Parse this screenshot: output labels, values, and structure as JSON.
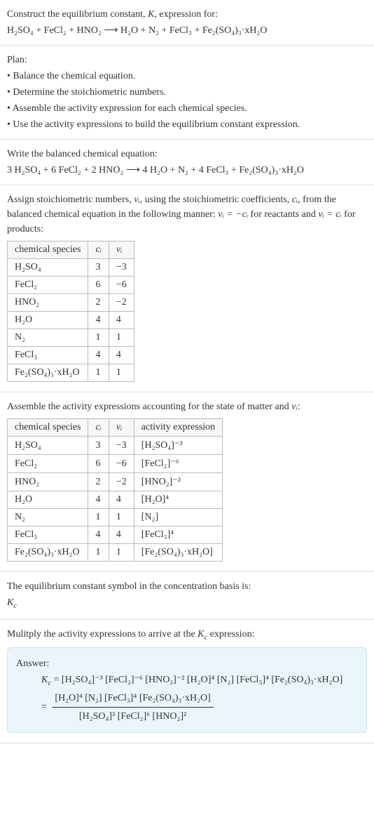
{
  "intro": {
    "line1_prefix": "Construct the equilibrium constant, ",
    "line1_K": "K",
    "line1_suffix": ", expression for:",
    "reaction_unbalanced": "H₂SO₄ + FeCl₂ + HNO₂ ⟶ H₂O + N₂ + FeCl₃ + Fe₂(SO₄)₃·xH₂O"
  },
  "plan": {
    "heading": "Plan:",
    "items": [
      "• Balance the chemical equation.",
      "• Determine the stoichiometric numbers.",
      "• Assemble the activity expression for each chemical species.",
      "• Use the activity expressions to build the equilibrium constant expression."
    ]
  },
  "balanced": {
    "heading": "Write the balanced chemical equation:",
    "reaction": "3 H₂SO₄ + 6 FeCl₂ + 2 HNO₂ ⟶ 4 H₂O + N₂ + 4 FeCl₃ + Fe₂(SO₄)₃·xH₂O"
  },
  "stoich": {
    "desc_prefix": "Assign stoichiometric numbers, ",
    "nu_i": "νᵢ",
    "desc_mid1": ", using the stoichiometric coefficients, ",
    "c_i": "cᵢ",
    "desc_mid2": ", from the balanced chemical equation in the following manner: ",
    "rule1": "νᵢ = −cᵢ",
    "desc_mid3": " for reactants and ",
    "rule2": "νᵢ = cᵢ",
    "desc_suffix": " for products:",
    "headers": [
      "chemical species",
      "cᵢ",
      "νᵢ"
    ],
    "rows": [
      [
        "H₂SO₄",
        "3",
        "−3"
      ],
      [
        "FeCl₂",
        "6",
        "−6"
      ],
      [
        "HNO₂",
        "2",
        "−2"
      ],
      [
        "H₂O",
        "4",
        "4"
      ],
      [
        "N₂",
        "1",
        "1"
      ],
      [
        "FeCl₃",
        "4",
        "4"
      ],
      [
        "Fe₂(SO₄)₃·xH₂O",
        "1",
        "1"
      ]
    ]
  },
  "activity": {
    "heading_prefix": "Assemble the activity expressions accounting for the state of matter and ",
    "heading_nu": "νᵢ",
    "heading_suffix": ":",
    "headers": [
      "chemical species",
      "cᵢ",
      "νᵢ",
      "activity expression"
    ],
    "rows": [
      [
        "H₂SO₄",
        "3",
        "−3",
        "[H₂SO₄]⁻³"
      ],
      [
        "FeCl₂",
        "6",
        "−6",
        "[FeCl₂]⁻⁶"
      ],
      [
        "HNO₂",
        "2",
        "−2",
        "[HNO₂]⁻²"
      ],
      [
        "H₂O",
        "4",
        "4",
        "[H₂O]⁴"
      ],
      [
        "N₂",
        "1",
        "1",
        "[N₂]"
      ],
      [
        "FeCl₃",
        "4",
        "4",
        "[FeCl₃]⁴"
      ],
      [
        "Fe₂(SO₄)₃·xH₂O",
        "1",
        "1",
        "[Fe₂(SO₄)₃·xH₂O]"
      ]
    ]
  },
  "kc_symbol": {
    "line1": "The equilibrium constant symbol in the concentration basis is:",
    "symbol": "K_c"
  },
  "multiply": {
    "line_prefix": "Mulitply the activity expressions to arrive at the ",
    "kc": "K_c",
    "line_suffix": " expression:"
  },
  "answer": {
    "label": "Answer:",
    "kc_eq": "K_c =",
    "flat": "[H₂SO₄]⁻³ [FeCl₂]⁻⁶ [HNO₂]⁻² [H₂O]⁴ [N₂] [FeCl₃]⁴ [Fe₂(SO₄)₃·xH₂O]",
    "eq_sign": "=",
    "frac_num": "[H₂O]⁴ [N₂] [FeCl₃]⁴ [Fe₂(SO₄)₃·xH₂O]",
    "frac_den": "[H₂SO₄]³ [FeCl₂]⁶ [HNO₂]²"
  },
  "chart_data": {
    "type": "table",
    "tables": [
      {
        "title": "Stoichiometric numbers",
        "headers": [
          "chemical species",
          "c_i",
          "nu_i"
        ],
        "rows": [
          [
            "H2SO4",
            3,
            -3
          ],
          [
            "FeCl2",
            6,
            -6
          ],
          [
            "HNO2",
            2,
            -2
          ],
          [
            "H2O",
            4,
            4
          ],
          [
            "N2",
            1,
            1
          ],
          [
            "FeCl3",
            4,
            4
          ],
          [
            "Fe2(SO4)3·xH2O",
            1,
            1
          ]
        ]
      },
      {
        "title": "Activity expressions",
        "headers": [
          "chemical species",
          "c_i",
          "nu_i",
          "activity expression"
        ],
        "rows": [
          [
            "H2SO4",
            3,
            -3,
            "[H2SO4]^-3"
          ],
          [
            "FeCl2",
            6,
            -6,
            "[FeCl2]^-6"
          ],
          [
            "HNO2",
            2,
            -2,
            "[HNO2]^-2"
          ],
          [
            "H2O",
            4,
            4,
            "[H2O]^4"
          ],
          [
            "N2",
            1,
            1,
            "[N2]"
          ],
          [
            "FeCl3",
            4,
            4,
            "[FeCl3]^4"
          ],
          [
            "Fe2(SO4)3·xH2O",
            1,
            1,
            "[Fe2(SO4)3·xH2O]"
          ]
        ]
      }
    ]
  }
}
